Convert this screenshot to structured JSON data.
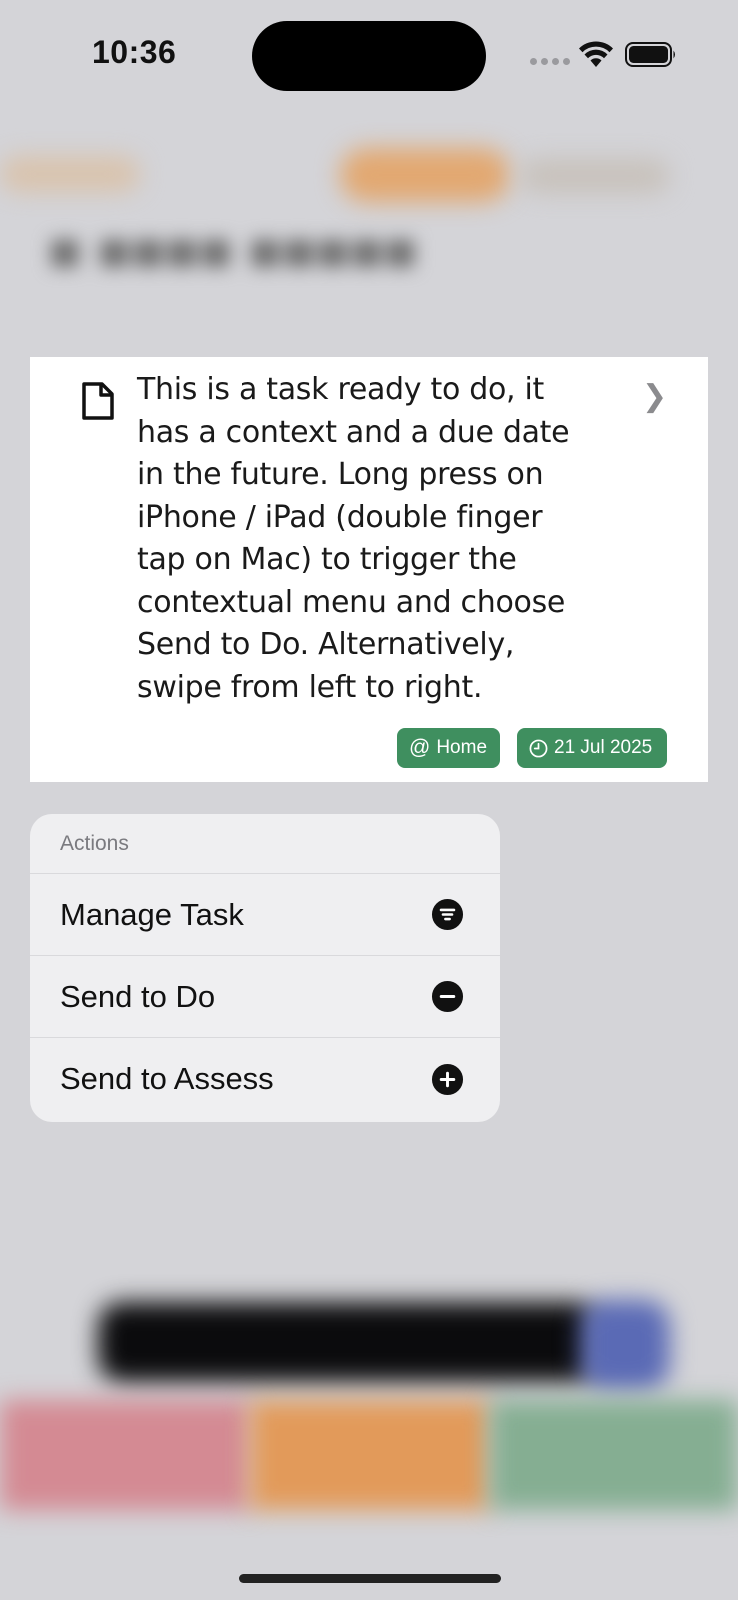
{
  "status_bar": {
    "time": "10:36"
  },
  "task": {
    "text": "This is a task ready to do, it has a context and a due date in the future. Long press on iPhone / iPad (double finger tap on Mac) to trigger the contextual menu and choose Send to Do. Alternatively, swipe from left to right.",
    "context_chip": {
      "symbol": "@",
      "label": "Home"
    },
    "date_chip": {
      "label": "21 Jul 2025"
    },
    "chip_color": "#3f8f5f"
  },
  "context_menu": {
    "header": "Actions",
    "items": [
      {
        "label": "Manage Task",
        "icon": "list-circle-icon"
      },
      {
        "label": "Send to Do",
        "icon": "minus-circle-icon"
      },
      {
        "label": "Send to Assess",
        "icon": "plus-circle-icon"
      }
    ]
  },
  "colors": {
    "accent_orange": "#e2a871",
    "menu_background": "#efeff1",
    "overlay_background": "#d4d4d8"
  }
}
